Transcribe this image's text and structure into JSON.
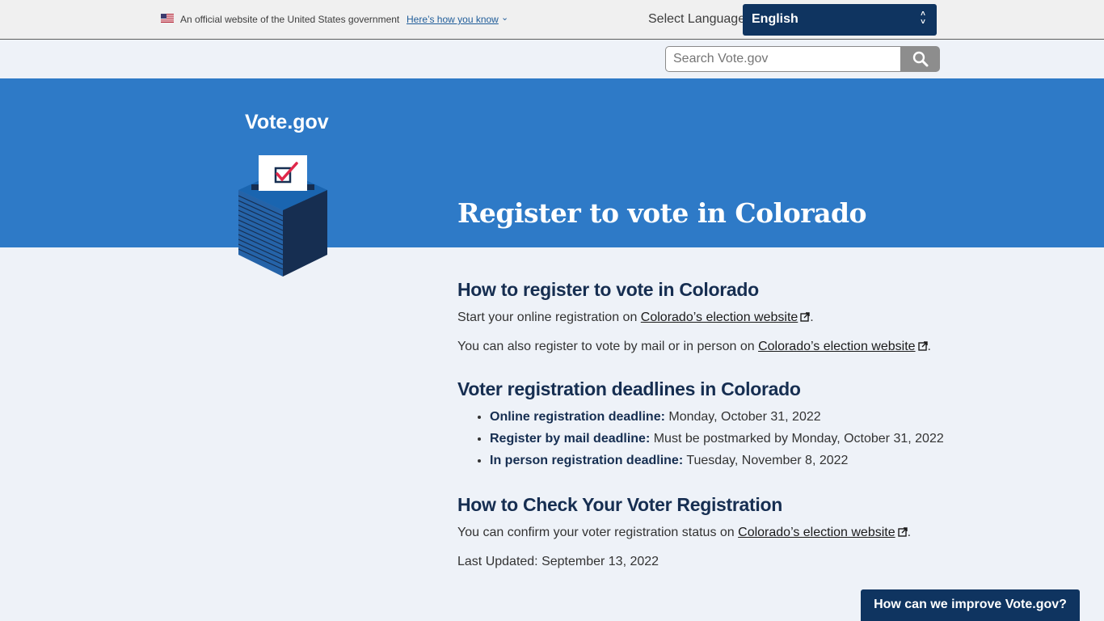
{
  "banner": {
    "official_text": "An official website of the United States government",
    "how_you_know": "Here’s how you know"
  },
  "language": {
    "label": "Select Language",
    "selected": "English"
  },
  "search": {
    "placeholder": "Search Vote.gov",
    "value": ""
  },
  "hero": {
    "logo_text": "Vote.gov",
    "title": "Register to vote in Colorado"
  },
  "sections": {
    "register": {
      "heading": "How to register to vote in Colorado",
      "p1_prefix": "Start your online registration on ",
      "p1_link": "Colorado’s election website",
      "p2_prefix": "You can also register to vote by mail or in person on ",
      "p2_link": "Colorado’s election website"
    },
    "deadlines": {
      "heading": "Voter registration deadlines in Colorado",
      "items": [
        {
          "label": "Online registration deadline:",
          "value": " Monday, October 31, 2022"
        },
        {
          "label": "Register by mail deadline:",
          "value": " Must be postmarked by Monday, October 31, 2022"
        },
        {
          "label": "In person registration deadline:",
          "value": " Tuesday, November 8, 2022"
        }
      ]
    },
    "check": {
      "heading": "How to Check Your Voter Registration",
      "p_prefix": "You can confirm your voter registration status on ",
      "p_link": "Colorado’s election website",
      "last_updated": "Last Updated: September 13, 2022"
    }
  },
  "feedback_button": "How can we improve Vote.gov?",
  "colors": {
    "hero_blue": "#2e7ac7",
    "navy": "#0f3460",
    "page_bg": "#eef2f8",
    "check_red": "#e0274a"
  }
}
